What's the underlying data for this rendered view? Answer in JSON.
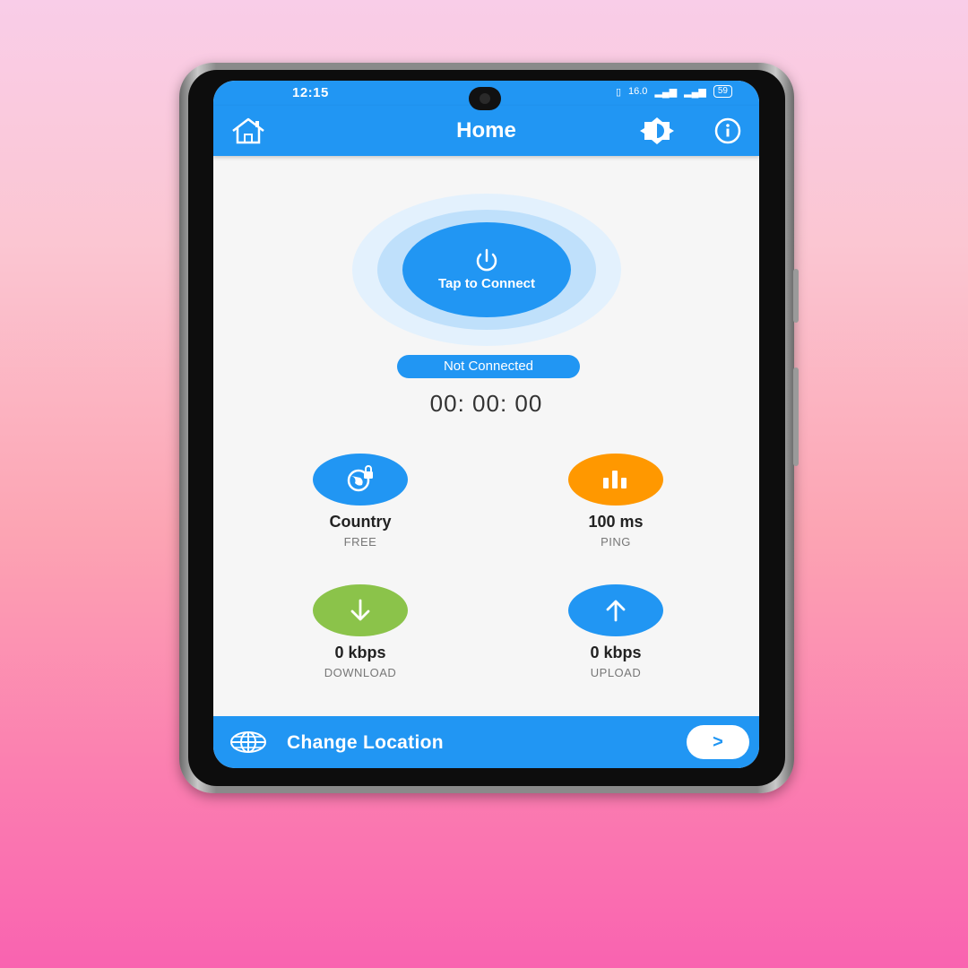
{
  "statusbar": {
    "time": "12:15",
    "net_speed": "16.0",
    "battery": "59"
  },
  "appbar": {
    "title": "Home",
    "icons": [
      "home-icon",
      "theme-icon",
      "info-icon"
    ]
  },
  "connect": {
    "button_label": "Tap to Connect",
    "status": "Not Connected",
    "timer": "00: 00: 00"
  },
  "stats": [
    {
      "value": "Country",
      "caption": "FREE",
      "icon": "globe-lock-icon",
      "color": "#2196f3"
    },
    {
      "value": "100 ms",
      "caption": "PING",
      "icon": "bar-chart-icon",
      "color": "#ff9800"
    },
    {
      "value": "0 kbps",
      "caption": "DOWNLOAD",
      "icon": "arrow-down-icon",
      "color": "#8bc34a"
    },
    {
      "value": "0 kbps",
      "caption": "UPLOAD",
      "icon": "arrow-up-icon",
      "color": "#2196f3"
    }
  ],
  "bottom_bar": {
    "label": "Change Location",
    "go": ">"
  },
  "colors": {
    "primary": "#2196f3",
    "ping": "#ff9800",
    "download": "#8bc34a"
  }
}
